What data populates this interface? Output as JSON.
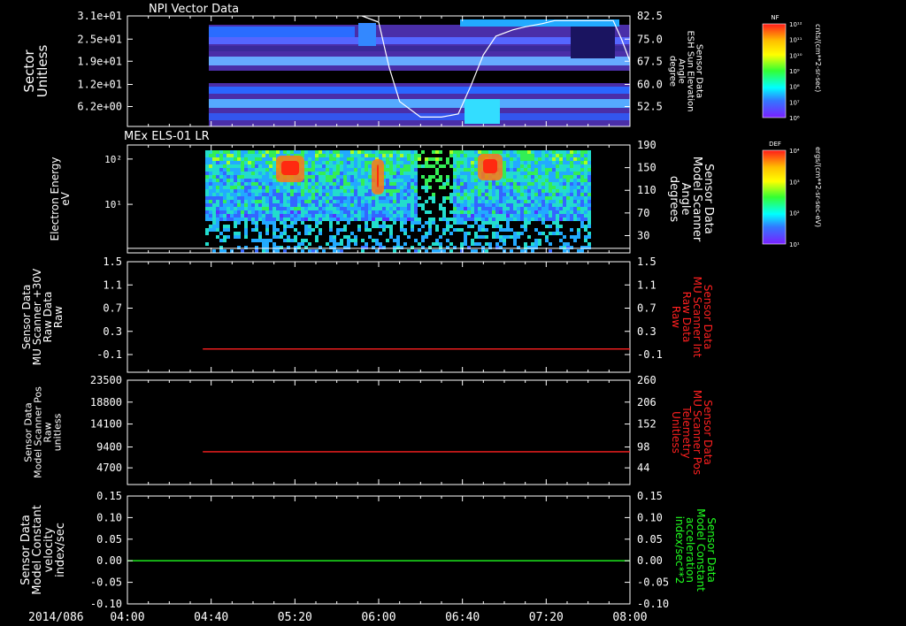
{
  "time_axis": {
    "date_label": "2014/086",
    "ticks": [
      "04:00",
      "04:40",
      "05:20",
      "06:00",
      "06:40",
      "07:20",
      "08:00"
    ],
    "range": [
      "04:00",
      "08:00"
    ]
  },
  "colorbars": [
    {
      "tag": "NF",
      "unit": "cnts/(cm**2-sr-sec)",
      "ticks": [
        "10¹²",
        "10¹¹",
        "10¹⁰",
        "10⁹",
        "10⁸",
        "10⁷",
        "10⁶"
      ]
    },
    {
      "tag": "DEF",
      "unit": "ergs/(cm**2-sr-sec-eV)",
      "ticks": [
        "10⁴",
        "10³",
        "10²",
        "10¹"
      ]
    }
  ],
  "chart_data": [
    {
      "type": "heatmap",
      "title": "NPI Vector Data",
      "ylabel_lines": [
        "Sector",
        "Unitless"
      ],
      "yticks": [
        "3.1e+01",
        "2.5e+01",
        "1.9e+01",
        "1.2e+01",
        "6.2e+00"
      ],
      "y2label_lines": [
        "Sensor Data",
        "ESH Sun Elevation",
        "Angle",
        "degree"
      ],
      "y2ticks": [
        "82.5",
        "75.0",
        "67.5",
        "60.0",
        "52.5"
      ],
      "y2lim": [
        47,
        82.5
      ],
      "overlay_line": {
        "series": "Sensor Data ESH Sun Elevation Angle",
        "x": [
          "05:52",
          "06:00",
          "06:05",
          "06:10",
          "06:20",
          "06:30",
          "06:38",
          "06:44",
          "06:50",
          "06:56",
          "07:04",
          "07:10",
          "07:18",
          "07:24",
          "07:32",
          "07:46",
          "07:52",
          "07:56",
          "08:00"
        ],
        "y": [
          82.5,
          80.5,
          66,
          55,
          50,
          50,
          51,
          60,
          70,
          76,
          78,
          79,
          80,
          81,
          81,
          81,
          81,
          75,
          68
        ]
      }
    },
    {
      "type": "heatmap",
      "title": "MEx ELS-01 LR",
      "ylabel_lines": [
        "Electron Energy",
        "eV"
      ],
      "yticks": [
        "10²",
        "10¹"
      ],
      "y2label_lines": [
        "Sensor Data",
        "Model Scanner",
        "Angle",
        "degrees"
      ],
      "y2ticks": [
        "190",
        "150",
        "110",
        "70",
        "30"
      ],
      "y2lim": [
        0,
        190
      ],
      "overlay_line": {
        "series": "Sensor Data Model Scanner Angle",
        "x": [
          "04:00",
          "08:00"
        ],
        "y": [
          8,
          8
        ]
      }
    },
    {
      "type": "line",
      "ylabel_lines": [
        "Sensor Data",
        "MU Scanner +30V",
        "Raw Data",
        "Raw"
      ],
      "yticks": [
        "1.5",
        "1.1",
        "0.7",
        "0.3",
        "-0.1"
      ],
      "ylim": [
        -0.4,
        1.5
      ],
      "y2label_lines": [
        "Sensor Data",
        "MU Scanner Int",
        "Raw Data",
        "Raw"
      ],
      "y2ticks": [
        "1.5",
        "1.1",
        "0.7",
        "0.3",
        "-0.1"
      ],
      "series": [
        {
          "name": "Sensor Data MU Scanner Int Raw Data",
          "color": "#ff2020",
          "x": [
            "04:36",
            "08:00"
          ],
          "y": [
            0.0,
            0.0
          ]
        }
      ]
    },
    {
      "type": "line",
      "ylabel_lines": [
        "Sensor Data",
        "Model Scanner Pos",
        "Raw",
        "unitless"
      ],
      "yticks": [
        "23500",
        "18800",
        "14100",
        "9400",
        "4700"
      ],
      "ylim": [
        1200,
        23500
      ],
      "y2label_lines": [
        "Sensor Data",
        "MU Scanner Pos",
        "Telemetry",
        "Unitless"
      ],
      "y2ticks": [
        "260",
        "206",
        "152",
        "98",
        "44"
      ],
      "series": [
        {
          "name": "Sensor Data MU Scanner Pos Telemetry",
          "color": "#ff2020",
          "x": [
            "04:36",
            "08:00"
          ],
          "y": [
            8200,
            8200
          ]
        }
      ]
    },
    {
      "type": "line",
      "ylabel_lines": [
        "Sensor Data",
        "Model Constant",
        "velocity",
        "index/sec"
      ],
      "yticks": [
        "0.15",
        "0.10",
        "0.05",
        "0.00",
        "-0.05",
        "-0.10"
      ],
      "ylim": [
        -0.1,
        0.15
      ],
      "y2label_lines": [
        "Sensor Data",
        "Model Constant",
        "acceleration",
        "index/sec**2"
      ],
      "y2ticks": [
        "0.15",
        "0.10",
        "0.05",
        "0.00",
        "-0.05",
        "-0.10"
      ],
      "series": [
        {
          "name": "Sensor Data Model Constant acceleration",
          "color": "#20ff20",
          "x": [
            "04:00",
            "08:00"
          ],
          "y": [
            0.0,
            0.0
          ]
        }
      ]
    }
  ],
  "colors": {
    "background": "#000000",
    "axes": "#ffffff",
    "red_label": "#ff2020",
    "green_label": "#20ff20"
  }
}
